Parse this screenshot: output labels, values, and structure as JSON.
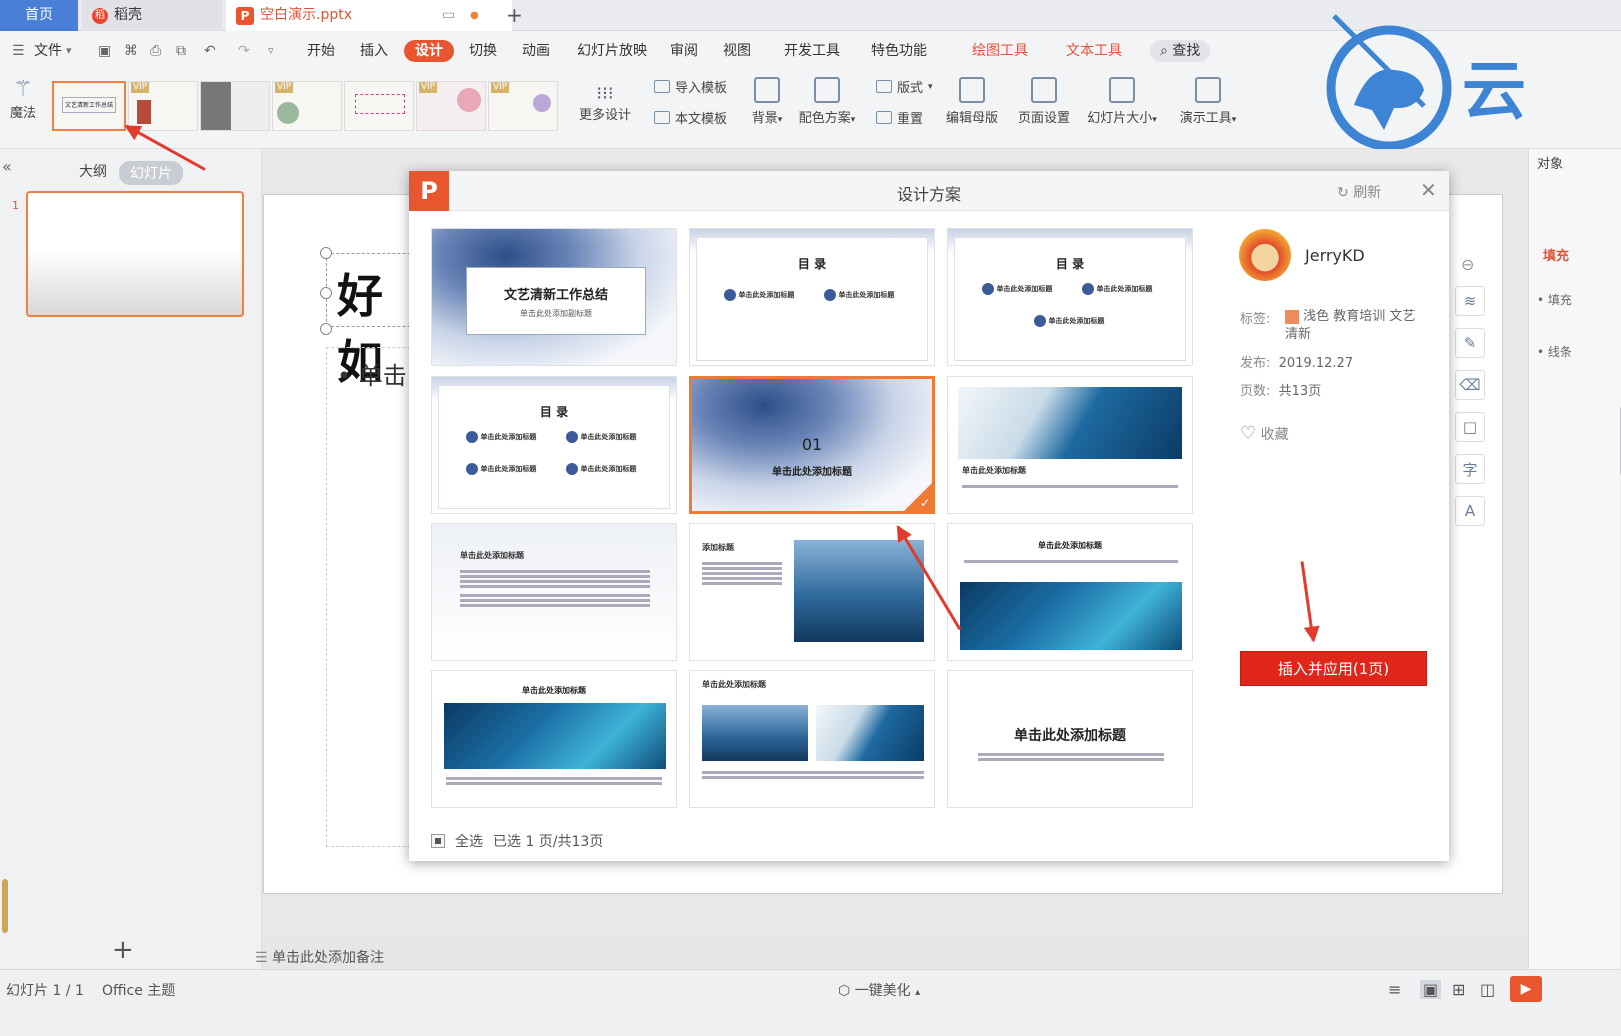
{
  "tabs": {
    "home": "首页",
    "daoke": "稻壳",
    "doc": "空白演示.pptx"
  },
  "menu": {
    "file": "文件",
    "start": "开始",
    "insert": "插入",
    "design": "设计",
    "switch": "切换",
    "animation": "动画",
    "slideshow": "幻灯片放映",
    "review": "审阅",
    "view": "视图",
    "devtools": "开发工具",
    "special": "特色功能",
    "drawtools": "绘图工具",
    "texttools": "文本工具",
    "search": "查找"
  },
  "ribbon": {
    "magic": "魔法",
    "more_design": "更多设计",
    "import_template": "导入模板",
    "this_template": "本文模板",
    "background": "背景",
    "color_scheme": "配色方案",
    "layout": "版式",
    "reset": "重置",
    "edit_master": "编辑母版",
    "page_setup": "页面设置",
    "slide_size": "幻灯片大小",
    "presentation_tools": "演示工具",
    "vip": "VIP",
    "thumb_text": "文艺清新工作总结"
  },
  "left_panel": {
    "outline": "大纲",
    "slides": "幻灯片",
    "slide_number": "1"
  },
  "slide": {
    "title_fragment": "好如",
    "bullet": "• 单击"
  },
  "right_panel": {
    "objects": "对象",
    "fill": "填充",
    "fill2": "• 填充",
    "line": "• 线条"
  },
  "brand": {
    "cloud_char": "云"
  },
  "notes": "单击此处添加备注",
  "status": {
    "slide_counter": "幻灯片 1 / 1",
    "theme": "Office 主题",
    "beautify": "一键美化"
  },
  "dialog": {
    "title": "设计方案",
    "refresh": "刷新",
    "author": "JerryKD",
    "tags_label": "标签:",
    "tags_value": "浅色 教育培训 文艺清新",
    "publish_label": "发布:",
    "publish_value": "2019.12.27",
    "pages_label": "页数:",
    "pages_value": "共13页",
    "favorite": "收藏",
    "apply_button": "插入并应用(1页)",
    "select_all": "全选",
    "selected_info": "已选 1 页/共13页",
    "cards": {
      "c1_title": "文艺清新工作总结",
      "c1_sub": "单击此处添加副标题",
      "toc": "目 录",
      "toc_item": "单击此处添加标题",
      "c5_num": "01",
      "c5_title": "单击此处添加标题",
      "add_title": "单击此处添加标题",
      "add_heading": "添加标题",
      "big_title": "单击此处添加标题"
    }
  }
}
